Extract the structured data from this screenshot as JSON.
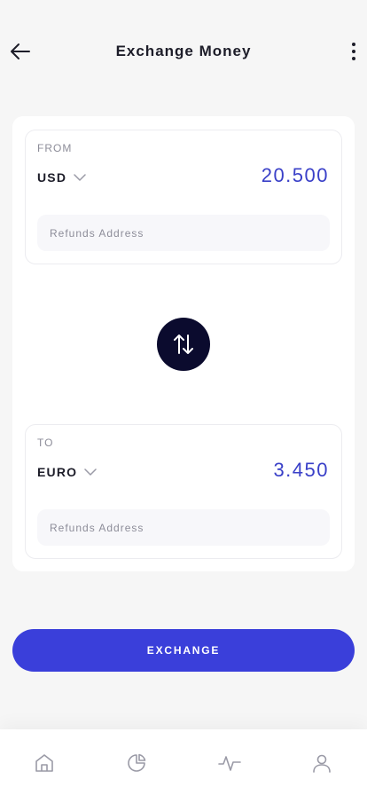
{
  "header": {
    "title": "Exchange Money",
    "back_icon": "arrow-left-icon",
    "more_icon": "more-vertical-icon"
  },
  "from": {
    "label": "FROM",
    "currency": "USD",
    "amount": "20.500",
    "refund_placeholder": "Refunds Address",
    "refund_value": ""
  },
  "to": {
    "label": "TO",
    "currency": "EURO",
    "amount": "3.450",
    "refund_placeholder": "Refunds Address",
    "refund_value": ""
  },
  "swap": {
    "icon": "swap-vertical-icon"
  },
  "actions": {
    "exchange_label": "EXCHANGE"
  },
  "tabbar": {
    "items": [
      {
        "icon": "home-icon"
      },
      {
        "icon": "pie-chart-icon"
      },
      {
        "icon": "activity-icon"
      },
      {
        "icon": "user-icon"
      }
    ]
  },
  "colors": {
    "accent": "#3a3fda",
    "amount_text": "#3a40c8",
    "swap_bg": "#0b0b2e",
    "background": "#f6f6f6",
    "icon_muted": "#9a9aa6"
  }
}
